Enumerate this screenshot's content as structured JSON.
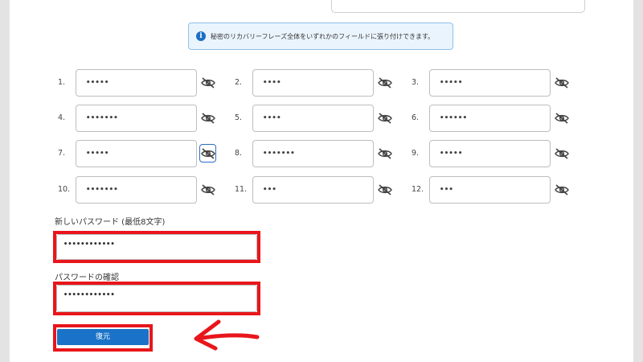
{
  "info": {
    "icon": "info-icon",
    "text": "秘密のリカバリーフレーズ全体をいずれかのフィールドに張り付けできます。"
  },
  "words": [
    {
      "num": "1.",
      "value": "•••••"
    },
    {
      "num": "2.",
      "value": "••••"
    },
    {
      "num": "3.",
      "value": "•••••"
    },
    {
      "num": "4.",
      "value": "•••••••"
    },
    {
      "num": "5.",
      "value": "••••"
    },
    {
      "num": "6.",
      "value": "••••••"
    },
    {
      "num": "7.",
      "value": "•••••"
    },
    {
      "num": "8.",
      "value": "•••••••"
    },
    {
      "num": "9.",
      "value": "•••••"
    },
    {
      "num": "10.",
      "value": "•••••••"
    },
    {
      "num": "11.",
      "value": "•••"
    },
    {
      "num": "12.",
      "value": "•••"
    }
  ],
  "new_password": {
    "label": "新しいパスワード (最低8文字)",
    "value": "••••••••••••"
  },
  "confirm_password": {
    "label": "パスワードの確認",
    "value": "••••••••••••"
  },
  "restore_button": {
    "label": "復元"
  },
  "colors": {
    "highlight": "#e8161b",
    "primary": "#1a73c8",
    "info_bg": "#eaf4fd"
  }
}
